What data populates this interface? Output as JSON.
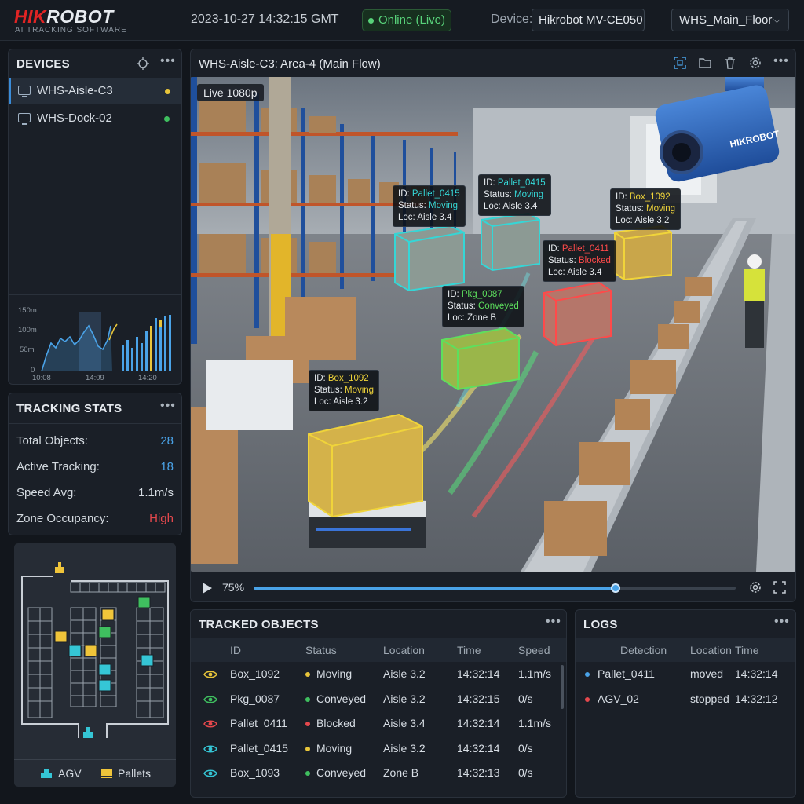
{
  "header": {
    "logo_brand": "HIKROBOT",
    "logo_subtitle": "AI TRACKING SOFTWARE",
    "datetime": "2023-10-27 14:32:15 GMT",
    "status": "Online (Live)",
    "device_label": "Device:",
    "device_name": "Hikrobot MV-CE050",
    "floor": "WHS_Main_Floor",
    "colors": {
      "status_green": "#58d27a",
      "brand_red": "#e02424"
    }
  },
  "devices": {
    "title": "DEVICES",
    "items": [
      {
        "name": "WHS-Aisle-C3",
        "dot_color": "#e8c53a"
      },
      {
        "name": "WHS-Dock-02",
        "dot_color": "#3fbf5f"
      }
    ],
    "chart": {
      "y_ticks": [
        "150m",
        "100m",
        "50m",
        "0"
      ],
      "x_ticks": [
        "10:08",
        "14:09",
        "14:20"
      ]
    }
  },
  "stats": {
    "title": "TRACKING STATS",
    "rows": [
      {
        "label": "Total Objects:",
        "value": "28",
        "color": "#4aa3e8"
      },
      {
        "label": "Active Tracking:",
        "value": "18",
        "color": "#4aa3e8"
      },
      {
        "label": "Speed Avg:",
        "value": "1.1m/s",
        "color": "#d7dde4"
      },
      {
        "label": "Zone Occupancy:",
        "value": "High",
        "color": "#e5484d"
      }
    ]
  },
  "map": {
    "legend_agv": "AGV",
    "legend_pallets": "Pallets"
  },
  "video": {
    "title": "WHS-Aisle-C3: Area-4 (Main Flow)",
    "live_badge": "Live 1080p",
    "camera_brand": "HIKROBOT",
    "zoom": "75%",
    "progress": 0.75,
    "labels": [
      {
        "id": "Pallet_0415",
        "status": "Moving",
        "loc": "Aisle 3.4",
        "color": "#35d6d6"
      },
      {
        "id": "Pallet_0415",
        "status": "Moving",
        "loc": "Aisle 3.4",
        "color": "#35d6d6"
      },
      {
        "id": "Box_1092",
        "status": "Moving",
        "loc": "Aisle 3.2",
        "color": "#f0d43a"
      },
      {
        "id": "Pallet_0411",
        "status": "Blocked",
        "loc": "Aisle 3.4",
        "color": "#ff4a4a"
      },
      {
        "id": "Pkg_0087",
        "status": "Conveyed",
        "loc": "Zone B",
        "color": "#5de05d"
      },
      {
        "id": "Box_1092",
        "status": "Moving",
        "loc": "Aisle 3.2",
        "color": "#f0d43a"
      }
    ],
    "id_prefix": "ID: ",
    "status_prefix": "Status: ",
    "loc_prefix": "Loc: "
  },
  "tracked": {
    "title": "TRACKED OBJECTS",
    "columns": [
      "ID",
      "Status",
      "Location",
      "Time",
      "Speed"
    ],
    "rows": [
      {
        "id": "Box_1092",
        "status": "Moving",
        "location": "Aisle 3.2",
        "time": "14:32:14",
        "speed": "1.1m/s",
        "eye": "#e8c53a",
        "dot": "#e8c53a"
      },
      {
        "id": "Pkg_0087",
        "status": "Conveyed",
        "location": "Aisle 3.2",
        "time": "14:32:15",
        "speed": "0/s",
        "eye": "#3fbf5f",
        "dot": "#3fbf5f"
      },
      {
        "id": "Pallet_0411",
        "status": "Blocked",
        "location": "Aisle 3.4",
        "time": "14:32:14",
        "speed": "1.1m/s",
        "eye": "#e5484d",
        "dot": "#e5484d"
      },
      {
        "id": "Pallet_0415",
        "status": "Moving",
        "location": "Aisle 3.2",
        "time": "14:32:14",
        "speed": "0/s",
        "eye": "#35c6d6",
        "dot": "#e8c53a"
      },
      {
        "id": "Box_1093",
        "status": "Conveyed",
        "location": "Zone B",
        "time": "14:32:13",
        "speed": "0/s",
        "eye": "#35c6d6",
        "dot": "#3fbf5f"
      }
    ]
  },
  "logs": {
    "title": "LOGS",
    "columns": [
      "Detection",
      "Location",
      "Time"
    ],
    "rows": [
      {
        "detection": "Pallet_0411",
        "location": "moved",
        "time": "14:32:14",
        "dot": "#4aa3e8"
      },
      {
        "detection": "AGV_02",
        "location": "stopped",
        "time": "14:32:12",
        "dot": "#e5484d"
      }
    ]
  }
}
